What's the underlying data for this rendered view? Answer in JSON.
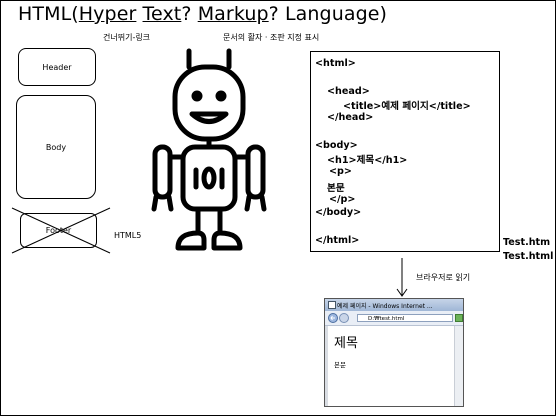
{
  "title": {
    "prefix": "HTML(",
    "w1": "Hyper",
    "sp1": " ",
    "w2": "Text",
    "q1": "? ",
    "w3": "Markup",
    "q2": "? Language)"
  },
  "labels": {
    "link": "건너뛰기-링크",
    "display": "문서의 활자 · 조판 지정 표시",
    "html5": "HTML5",
    "read": "브라우저로 읽기"
  },
  "boxes": {
    "header": "Header",
    "body": "Body",
    "footer": "Footer"
  },
  "code": {
    "l1": "<html>",
    "l2": "<head>",
    "l3": "<title>예제 페이지</title>",
    "l4": "</head>",
    "l5": "<body>",
    "l6": "<h1>제목</h1>",
    "l7": "<p>",
    "l8": "본문",
    "l9": "</p>",
    "l10": "</body>",
    "l11": "</html>"
  },
  "files": [
    "Test.htm",
    "Test.html"
  ],
  "browser": {
    "title": "예제 페이지 - Windows Internet ...",
    "address": "D:₩test.html",
    "heading": "제목",
    "paragraph": "본문"
  }
}
